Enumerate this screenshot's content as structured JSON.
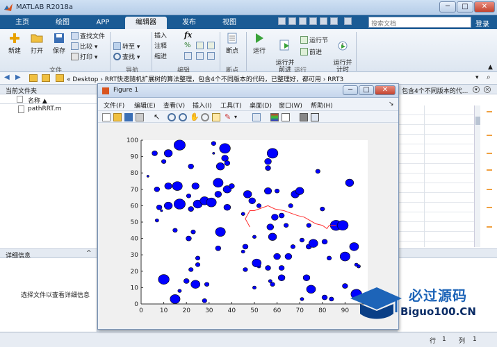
{
  "window": {
    "title": "MATLAB R2018a"
  },
  "tabs": [
    "主页",
    "绘图",
    "APP",
    "编辑器",
    "发布",
    "视图"
  ],
  "active_tab": "编辑器",
  "search": {
    "placeholder": "搜索文档"
  },
  "help": "登录",
  "ribbon": {
    "file_group": {
      "new": "新建",
      "open": "打开",
      "save": "保存",
      "find_files": "查找文件",
      "compare": "比较",
      "print": "打印",
      "label": "文件"
    },
    "nav_group": {
      "goto": "转至",
      "find": "查找",
      "label": "导航"
    },
    "edit_group": {
      "insert": "插入",
      "comment": "注释",
      "indent": "缩进",
      "label": "编辑"
    },
    "breakpoint_group": {
      "breakpoints": "断点",
      "label": "断点"
    },
    "run_group": {
      "run": "运行",
      "run_advance": "运行并\n前进",
      "run_section": "运行节",
      "advance": "前进",
      "run_time": "运行并\n计时",
      "label": "运行"
    }
  },
  "address": {
    "path": "« Desktop › RRT快速随机扩展树的算法整理，包含4个不同版本的代码，已整理好，都可用 › RRT3"
  },
  "left_panel": {
    "title": "当前文件夹",
    "column_name": "名称 ▲",
    "file": "pathRRT.m",
    "details_title": "详细信息",
    "details_text": "选择文件以查看详细信息"
  },
  "right_panel": {
    "tab_text": "包含4个不同版本的代..."
  },
  "status": {
    "row_label": "行",
    "row_value": "1",
    "col_label": "列",
    "col_value": "1"
  },
  "figure": {
    "title": "Figure 1",
    "menus": [
      "文件(F)",
      "编辑(E)",
      "查看(V)",
      "插入(I)",
      "工具(T)",
      "桌面(D)",
      "窗口(W)",
      "帮助(H)"
    ]
  },
  "watermark": {
    "line1": "必过源码",
    "line2": "Biguo100.CN"
  },
  "chart_data": {
    "type": "scatter",
    "title": "",
    "xlabel": "",
    "ylabel": "",
    "xlim": [
      0,
      100
    ],
    "ylim": [
      0,
      100
    ],
    "xticks": [
      0,
      10,
      20,
      30,
      40,
      50,
      60,
      70,
      80,
      90
    ],
    "yticks": [
      0,
      10,
      20,
      30,
      40,
      50,
      60,
      70,
      80,
      90,
      100
    ],
    "obstacle_color": "#0000ff",
    "path_color": "#ff3030",
    "obstacles": [
      {
        "x": 6,
        "y": 92,
        "r": 1.2
      },
      {
        "x": 12,
        "y": 92,
        "r": 1.8
      },
      {
        "x": 17,
        "y": 97,
        "r": 2.5
      },
      {
        "x": 22,
        "y": 84,
        "r": 1.2
      },
      {
        "x": 10,
        "y": 87,
        "r": 1.0
      },
      {
        "x": 32,
        "y": 98,
        "r": 1.0
      },
      {
        "x": 37,
        "y": 95,
        "r": 2.4
      },
      {
        "x": 37,
        "y": 89,
        "r": 1.5
      },
      {
        "x": 38,
        "y": 86,
        "r": 1.2
      },
      {
        "x": 35,
        "y": 84,
        "r": 1.8
      },
      {
        "x": 58,
        "y": 92,
        "r": 2.4
      },
      {
        "x": 56,
        "y": 87,
        "r": 1.5
      },
      {
        "x": 56,
        "y": 83,
        "r": 1.2
      },
      {
        "x": 78,
        "y": 81,
        "r": 1.0
      },
      {
        "x": 92,
        "y": 74,
        "r": 1.8
      },
      {
        "x": 7,
        "y": 70,
        "r": 1.2
      },
      {
        "x": 12,
        "y": 72,
        "r": 1.6
      },
      {
        "x": 16,
        "y": 72,
        "r": 2.2
      },
      {
        "x": 24,
        "y": 72,
        "r": 1.6
      },
      {
        "x": 21,
        "y": 66,
        "r": 1.0
      },
      {
        "x": 34,
        "y": 74,
        "r": 2.2
      },
      {
        "x": 38,
        "y": 70,
        "r": 1.8
      },
      {
        "x": 34,
        "y": 67,
        "r": 1.5
      },
      {
        "x": 40,
        "y": 72,
        "r": 1.2
      },
      {
        "x": 47,
        "y": 67,
        "r": 1.8
      },
      {
        "x": 49,
        "y": 63,
        "r": 1.5
      },
      {
        "x": 56,
        "y": 69,
        "r": 1.6
      },
      {
        "x": 60,
        "y": 69,
        "r": 1.0
      },
      {
        "x": 68,
        "y": 67,
        "r": 1.8
      },
      {
        "x": 70,
        "y": 69,
        "r": 1.8
      },
      {
        "x": 7,
        "y": 51,
        "r": 0.8
      },
      {
        "x": 8,
        "y": 59,
        "r": 1.2
      },
      {
        "x": 12,
        "y": 60,
        "r": 1.8
      },
      {
        "x": 17,
        "y": 61,
        "r": 2.5
      },
      {
        "x": 22,
        "y": 58,
        "r": 1.2
      },
      {
        "x": 25,
        "y": 61,
        "r": 2.0
      },
      {
        "x": 28,
        "y": 63,
        "r": 2.0
      },
      {
        "x": 31,
        "y": 62,
        "r": 2.2
      },
      {
        "x": 38,
        "y": 59,
        "r": 1.5
      },
      {
        "x": 45,
        "y": 55,
        "r": 0.8
      },
      {
        "x": 59,
        "y": 53,
        "r": 1.5
      },
      {
        "x": 62,
        "y": 54,
        "r": 1.2
      },
      {
        "x": 52,
        "y": 60,
        "r": 1.0
      },
      {
        "x": 66,
        "y": 60,
        "r": 1.0
      },
      {
        "x": 80,
        "y": 58,
        "r": 1.0
      },
      {
        "x": 86,
        "y": 48,
        "r": 2.5
      },
      {
        "x": 89,
        "y": 48,
        "r": 2.4
      },
      {
        "x": 57,
        "y": 47,
        "r": 1.5
      },
      {
        "x": 64,
        "y": 48,
        "r": 1.0
      },
      {
        "x": 74,
        "y": 48,
        "r": 1.0
      },
      {
        "x": 15,
        "y": 45,
        "r": 1.0
      },
      {
        "x": 23,
        "y": 44,
        "r": 1.0
      },
      {
        "x": 35,
        "y": 44,
        "r": 2.2
      },
      {
        "x": 58,
        "y": 41,
        "r": 1.8
      },
      {
        "x": 50,
        "y": 41,
        "r": 0.8
      },
      {
        "x": 21,
        "y": 40,
        "r": 1.2
      },
      {
        "x": 34,
        "y": 34,
        "r": 1.2
      },
      {
        "x": 46,
        "y": 35,
        "r": 1.2
      },
      {
        "x": 45,
        "y": 32,
        "r": 0.8
      },
      {
        "x": 67,
        "y": 35,
        "r": 1.0
      },
      {
        "x": 74,
        "y": 35,
        "r": 1.2
      },
      {
        "x": 76,
        "y": 37,
        "r": 2.0
      },
      {
        "x": 94,
        "y": 35,
        "r": 2.0
      },
      {
        "x": 81,
        "y": 38,
        "r": 1.2
      },
      {
        "x": 71,
        "y": 39,
        "r": 1.0
      },
      {
        "x": 60,
        "y": 29,
        "r": 1.5
      },
      {
        "x": 65,
        "y": 29,
        "r": 1.5
      },
      {
        "x": 62,
        "y": 22,
        "r": 1.2
      },
      {
        "x": 56,
        "y": 22,
        "r": 1.2
      },
      {
        "x": 52,
        "y": 23,
        "r": 0.8
      },
      {
        "x": 83,
        "y": 28,
        "r": 1.0
      },
      {
        "x": 90,
        "y": 29,
        "r": 2.2
      },
      {
        "x": 96,
        "y": 23,
        "r": 0.8
      },
      {
        "x": 25,
        "y": 28,
        "r": 1.0
      },
      {
        "x": 25,
        "y": 24,
        "r": 1.0
      },
      {
        "x": 22,
        "y": 21,
        "r": 1.0
      },
      {
        "x": 46,
        "y": 21,
        "r": 1.0
      },
      {
        "x": 51,
        "y": 25,
        "r": 2.0
      },
      {
        "x": 10,
        "y": 15,
        "r": 2.4
      },
      {
        "x": 20,
        "y": 14,
        "r": 1.2
      },
      {
        "x": 24,
        "y": 12,
        "r": 2.0
      },
      {
        "x": 29,
        "y": 12,
        "r": 1.0
      },
      {
        "x": 17,
        "y": 8,
        "r": 0.8
      },
      {
        "x": 15,
        "y": 3,
        "r": 2.2
      },
      {
        "x": 28,
        "y": 2,
        "r": 1.0
      },
      {
        "x": 58,
        "y": 12,
        "r": 1.0
      },
      {
        "x": 57,
        "y": 14,
        "r": 0.8
      },
      {
        "x": 62,
        "y": 16,
        "r": 1.5
      },
      {
        "x": 73,
        "y": 16,
        "r": 1.5
      },
      {
        "x": 75,
        "y": 9,
        "r": 2.0
      },
      {
        "x": 71,
        "y": 3,
        "r": 0.8
      },
      {
        "x": 81,
        "y": 4,
        "r": 1.2
      },
      {
        "x": 84,
        "y": 3,
        "r": 1.0
      },
      {
        "x": 90,
        "y": 11,
        "r": 1.2
      },
      {
        "x": 95,
        "y": 6,
        "r": 2.4
      },
      {
        "x": 50,
        "y": 10,
        "r": 0.8
      },
      {
        "x": 32,
        "y": 92,
        "r": 0.5
      },
      {
        "x": 3,
        "y": 78,
        "r": 0.5
      },
      {
        "x": 9,
        "y": 57,
        "r": 0.5
      },
      {
        "x": 95,
        "y": 24,
        "r": 0.8
      }
    ],
    "path": [
      [
        48,
        47
      ],
      [
        46,
        52
      ],
      [
        48,
        57
      ],
      [
        50,
        57
      ],
      [
        56,
        60
      ],
      [
        59,
        58
      ],
      [
        63,
        57
      ],
      [
        69,
        54
      ],
      [
        72,
        53
      ],
      [
        77,
        49
      ],
      [
        80,
        48
      ],
      [
        82,
        46
      ],
      [
        83,
        48
      ],
      [
        86,
        48
      ]
    ]
  }
}
